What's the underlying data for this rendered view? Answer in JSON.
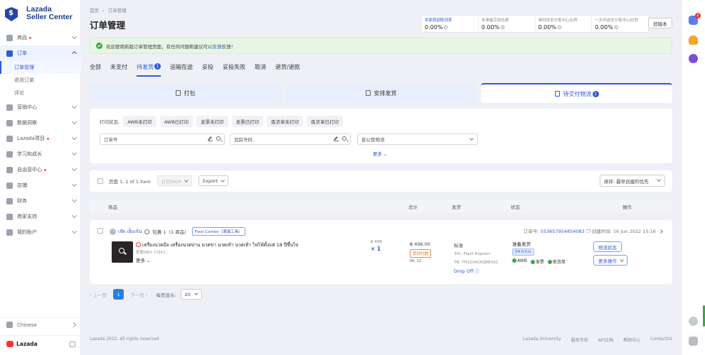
{
  "brand": {
    "line1": "Lazada",
    "line2": "Seller Center",
    "footer_name": "Lazada"
  },
  "sidebar": {
    "items": [
      {
        "label": "商品",
        "dot": true
      },
      {
        "label": "订单",
        "open": true
      },
      {
        "label": "营销中心"
      },
      {
        "label": "数据洞察"
      },
      {
        "label": "Lazada项目",
        "dot": true
      },
      {
        "label": "学习和成长"
      },
      {
        "label": "自运营中心",
        "dot": true
      },
      {
        "label": "店铺"
      },
      {
        "label": "财务"
      },
      {
        "label": "商家支持"
      },
      {
        "label": "我的账户"
      }
    ],
    "sub_items": [
      {
        "label": "订单管理",
        "active": true
      },
      {
        "label": "退货订单"
      },
      {
        "label": "评论"
      }
    ],
    "language": "Chinese"
  },
  "header": {
    "breadcrumb": [
      "首页",
      "›",
      "订单管理"
    ],
    "title": "订单管理",
    "old_version_label": "旧版本"
  },
  "stats": [
    {
      "label": "卖家原因取消率",
      "value": "0.00%",
      "link": true
    },
    {
      "label": "未准备完成包裹",
      "value": "0.00%"
    },
    {
      "label": "准时送至分拣中心比例",
      "value": "0.00%"
    },
    {
      "label": "一天内送至分拣中心比例",
      "value": "0.00%"
    }
  ],
  "banner": {
    "text": "欢迎使用新版订单管理页面，有任何问题和建议可以",
    "link": "反馈",
    "suffix": "反馈！"
  },
  "tabs": [
    {
      "label": "全部"
    },
    {
      "label": "未支付"
    },
    {
      "label": "待发货",
      "badge": "1",
      "active": true
    },
    {
      "label": "运输在途"
    },
    {
      "label": "妥投"
    },
    {
      "label": "妥投失败"
    },
    {
      "label": "取消"
    },
    {
      "label": "退货/退款"
    }
  ],
  "subtabs": [
    {
      "label": "打包"
    },
    {
      "label": "安排发货"
    },
    {
      "label": "待交付物流",
      "badge": "1",
      "active": true
    }
  ],
  "filters": {
    "print_label": "打印状态:",
    "chips": [
      "AWB未打印",
      "AWB已打印",
      "发票未打印",
      "发票已打印",
      "拣货单未打印",
      "拣货单已打印"
    ],
    "order_no_placeholder": "订单号",
    "tracking_placeholder": "追踪号码",
    "logistics_value": "普公管物流",
    "more": "更多"
  },
  "toolbar": {
    "page_text": "页面 1, 1 of 1 item",
    "print_awb": "打印AWB",
    "export": "Export",
    "sort": "排序: 最早创建的优先"
  },
  "table_headers": [
    "商品",
    "总计",
    "发货",
    "状态",
    "操作"
  ],
  "order": {
    "seller": "เจ๊ด เฮ็มเจ้น",
    "package": "包裹 1（1 商品）",
    "tag": "Flexi Combo（满减工具）",
    "order_no_label": "订单号:",
    "order_no": "553657954854083",
    "created": "创建时间: 16 Jun 2022 15:16",
    "product_name": "เครื่องนวดมือ เครื่องนวดบ่าน นวดขา นวดเท้า นวดเท้า ไฟไฟ้ตั้งแต่ 18 ปีขึ้นไป",
    "sku": "卖家SKU: CYJX1",
    "more": "更多",
    "unit_price": "฿ 498",
    "qty": "× 1",
    "total": "฿ 496.00",
    "payment": "货到付款",
    "in": "IN: 12",
    "ship_type": "标准",
    "provider": "3PL: Flash Express",
    "tracking": "TN: TH12042XQBR5SC",
    "drop": "Drop Off",
    "status": "准备发货",
    "hours": "54.0 hrs",
    "checks": [
      "AWB",
      "发票",
      "拣货单"
    ],
    "btn_logistics": "物流状态",
    "btn_more": "更多操作"
  },
  "pager": {
    "prev": "上一页",
    "page": "1",
    "next": "下一页",
    "per_label": "每页显示:",
    "per_value": "20"
  },
  "footer": {
    "copyright": "Lazada 2022. All rights reserved.",
    "links": [
      "Lazada University",
      "服务市场",
      "API文档",
      "帮助中心",
      "ContactUs"
    ]
  },
  "rail": {
    "badge": "2"
  },
  "colors": {
    "primary": "#2c5bd6",
    "brand": "#1a3b8f",
    "success": "#3aa845",
    "banner_bg": "#e6f5e4"
  }
}
